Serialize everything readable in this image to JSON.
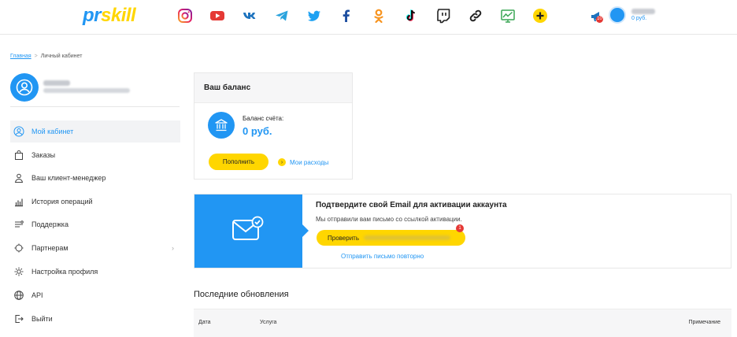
{
  "header": {
    "logo": {
      "part1": "pr",
      "part2": "skill"
    },
    "social_icons": [
      "instagram-icon",
      "youtube-icon",
      "vk-icon",
      "telegram-icon",
      "twitter-icon",
      "facebook-icon",
      "odnoklassniki-icon",
      "tiktok-icon",
      "twitch-icon",
      "link-icon",
      "stats-icon",
      "plus-icon"
    ],
    "notifications_badge": "10",
    "balance": "0 руб."
  },
  "breadcrumb": {
    "home": "Главная",
    "current": "Личный кабинет"
  },
  "sidebar": {
    "items": [
      {
        "label": "Мой кабинет",
        "icon": "user-circle-icon",
        "active": true
      },
      {
        "label": "Заказы",
        "icon": "bag-icon"
      },
      {
        "label": "Ваш клиент-менеджер",
        "icon": "manager-icon"
      },
      {
        "label": "История операций",
        "icon": "history-chart-icon"
      },
      {
        "label": "Поддержка",
        "icon": "support-icon"
      },
      {
        "label": "Партнерам",
        "icon": "partners-icon",
        "has_chevron": true
      },
      {
        "label": "Настройка профиля",
        "icon": "gear-icon"
      },
      {
        "label": "API",
        "icon": "api-globe-icon"
      },
      {
        "label": "Выйти",
        "icon": "logout-icon"
      }
    ]
  },
  "balance_card": {
    "title": "Ваш баланс",
    "label": "Баланс счёта:",
    "value": "0 руб.",
    "topup_label": "Пополнить",
    "expenses_label": "Мои расходы"
  },
  "email_confirm": {
    "title": "Подтвердите свой Email для активации аккаунта",
    "subtitle": "Мы отправили вам письмо со ссылкой активации.",
    "verify_label": "Проверить",
    "badge": "1",
    "resend_label": "Отправить письмо повторно"
  },
  "updates": {
    "title": "Последние обновления",
    "columns": [
      "Дата",
      "Услуга",
      "Примечание"
    ]
  },
  "colors": {
    "primary": "#2196f3",
    "accent": "#ffd600",
    "badge": "#e53935"
  }
}
